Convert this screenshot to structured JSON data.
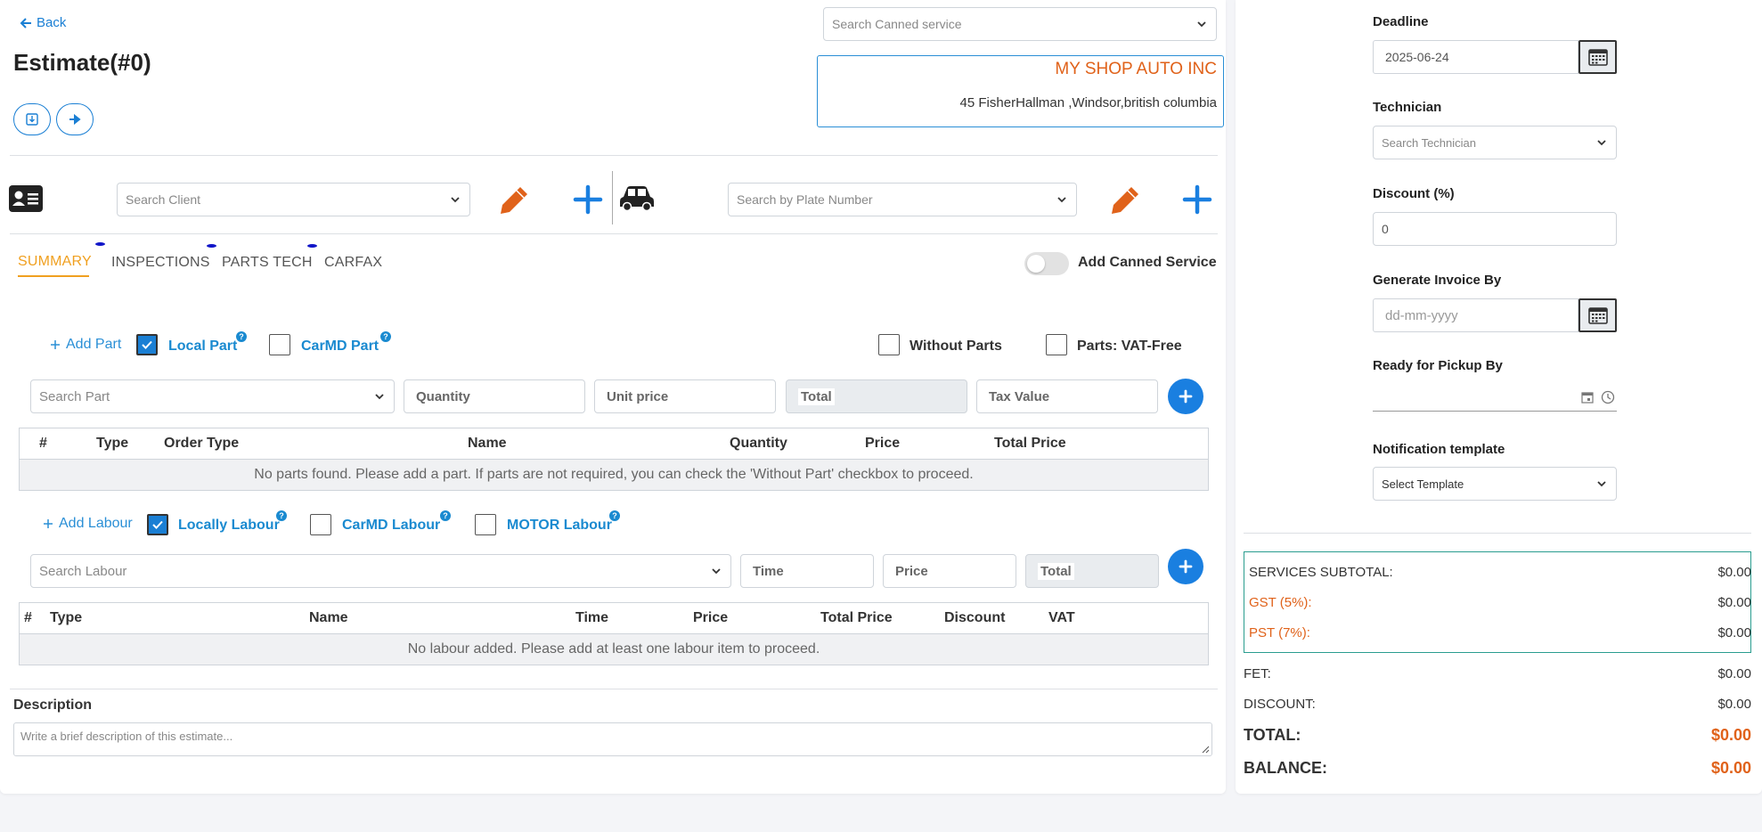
{
  "header": {
    "back_label": "Back",
    "title": "Estimate(#0)",
    "canned_search_placeholder": "Search Canned service",
    "shop_name": "MY SHOP AUTO INC",
    "shop_address": "45 FisherHallman ,Windsor,british columbia"
  },
  "client_bar": {
    "client_placeholder": "Search Client",
    "plate_placeholder": "Search by Plate Number"
  },
  "tabs": [
    {
      "label": "SUMMARY",
      "active": true
    },
    {
      "label": "INSPECTIONS"
    },
    {
      "label": "PARTS TECH"
    },
    {
      "label": "CARFAX"
    }
  ],
  "add_canned_label": "Add Canned Service",
  "parts": {
    "add_label": "Add Part",
    "local_label": "Local Part",
    "carmd_label": "CarMD Part",
    "without_label": "Without Parts",
    "vat_free_label": "Parts: VAT-Free",
    "search_placeholder": "Search Part",
    "quantity_placeholder": "Quantity",
    "unit_price_placeholder": "Unit price",
    "total_placeholder": "Total",
    "tax_placeholder": "Tax Value",
    "columns": [
      "#",
      "Type",
      "Order Type",
      "Name",
      "Quantity",
      "Price",
      "Total Price"
    ],
    "empty_message": "No parts found. Please add a part. If parts are not required, you can check the 'Without Part' checkbox to proceed."
  },
  "labour": {
    "add_label": "Add Labour",
    "local_label": "Locally Labour",
    "carmd_label": "CarMD Labour",
    "motor_label": "MOTOR Labour",
    "search_placeholder": "Search Labour",
    "time_placeholder": "Time",
    "price_placeholder": "Price",
    "total_placeholder": "Total",
    "columns": [
      "#",
      "Type",
      "Name",
      "Time",
      "Price",
      "Total Price",
      "Discount",
      "VAT"
    ],
    "empty_message": "No labour added. Please add at least one labour item to proceed."
  },
  "description": {
    "label": "Description",
    "placeholder": "Write a brief description of this estimate..."
  },
  "sidebar": {
    "deadline_label": "Deadline",
    "deadline_value": "2025-06-24",
    "technician_label": "Technician",
    "technician_placeholder": "Search Technician",
    "discount_label": "Discount (%)",
    "discount_value": "0",
    "invoice_label": "Generate Invoice By",
    "invoice_placeholder": "dd-mm-yyyy",
    "pickup_label": "Ready for Pickup By",
    "notification_label": "Notification template",
    "notification_placeholder": "Select Template"
  },
  "totals": {
    "services_subtotal": {
      "label": "SERVICES SUBTOTAL:",
      "value": "$0.00"
    },
    "gst": {
      "label": "GST (5%):",
      "value": "$0.00"
    },
    "pst": {
      "label": "PST (7%):",
      "value": "$0.00"
    },
    "fet": {
      "label": "FET:",
      "value": "$0.00"
    },
    "discount": {
      "label": "DISCOUNT:",
      "value": "$0.00"
    },
    "total": {
      "label": "TOTAL:",
      "value": "$0.00"
    },
    "balance": {
      "label": "BALANCE:",
      "value": "$0.00"
    }
  },
  "colors": {
    "accent": "#1a7fd4",
    "orange": "#e0621a",
    "tab_active": "#f0a020"
  }
}
